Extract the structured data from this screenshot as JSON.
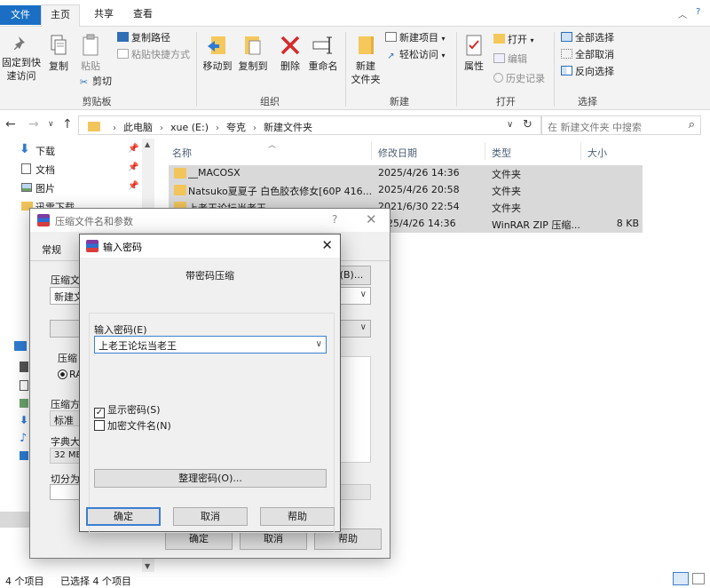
{
  "tabs": [
    "文件",
    "主页",
    "共享",
    "查看"
  ],
  "ribbon": {
    "clipboard": {
      "pin_quick_access": "固定到快\n速访问",
      "copy": "复制",
      "paste": "粘贴",
      "copy_path": "复制路径",
      "paste_shortcut": "粘贴快捷方式",
      "cut": "剪切",
      "group": "剪贴板"
    },
    "organize": {
      "move_to": "移动到",
      "copy_to": "复制到",
      "delete": "删除",
      "rename": "重命名",
      "group": "组织"
    },
    "new": {
      "new_folder": "新建\n文件夹",
      "new_item": "新建项目",
      "easy_access": "轻松访问",
      "group": "新建"
    },
    "open": {
      "properties": "属性",
      "open": "打开",
      "edit": "编辑",
      "history": "历史记录",
      "group": "打开"
    },
    "select": {
      "select_all": "全部选择",
      "select_none": "全部取消",
      "invert": "反向选择",
      "group": "选择"
    }
  },
  "address": {
    "crumbs": [
      "此电脑",
      "xue (E:)",
      "夸克",
      "新建文件夹"
    ],
    "search_placeholder": "在 新建文件夹 中搜索"
  },
  "nav_pane": [
    {
      "label": "下载",
      "icon": "download-arrow-icon"
    },
    {
      "label": "文档",
      "icon": "document-icon"
    },
    {
      "label": "图片",
      "icon": "picture-icon"
    },
    {
      "label": "迅雷下载",
      "icon": "folder-icon"
    }
  ],
  "columns": {
    "name": "名称",
    "date": "修改日期",
    "type": "类型",
    "size": "大小"
  },
  "files": [
    {
      "name": "__MACOSX",
      "date": "2025/4/26 14:36",
      "type": "文件夹",
      "size": ""
    },
    {
      "name": "Natsuko夏夏子 白色胶衣修女[60P 416...",
      "date": "2025/4/26 20:58",
      "type": "文件夹",
      "size": ""
    },
    {
      "name": "上老王论坛当老王",
      "date": "2021/6/30 22:54",
      "type": "文件夹",
      "size": ""
    },
    {
      "name": "",
      "date": "25/4/26 14:36",
      "type": "WinRAR ZIP 压缩...",
      "size": "8 KB"
    }
  ],
  "status": {
    "count": "4 个项目",
    "selected": "已选择 4 个项目"
  },
  "archive_dialog": {
    "title": "压缩文件名和参数",
    "help_glyph": "?",
    "tab_general": "常规",
    "archive_name_label": "压缩文",
    "archive_name_value": "新建文",
    "browse": "(B)...",
    "compress_label": "压缩",
    "rar_radio": "RA",
    "method_label": "压缩方",
    "method_value": "标准",
    "dict_label": "字典大",
    "dict_value": "32 MB",
    "split_label": "切分为",
    "ok": "确定",
    "cancel": "取消",
    "help": "帮助"
  },
  "password_dialog": {
    "title": "输入密码",
    "heading": "带密码压缩",
    "input_label": "输入密码(E)",
    "password_value": "上老王论坛当老王",
    "show_password": "显示密码(S)",
    "encrypt_names": "加密文件名(N)",
    "organize": "整理密码(O)...",
    "ok": "确定",
    "cancel": "取消",
    "help": "帮助"
  }
}
